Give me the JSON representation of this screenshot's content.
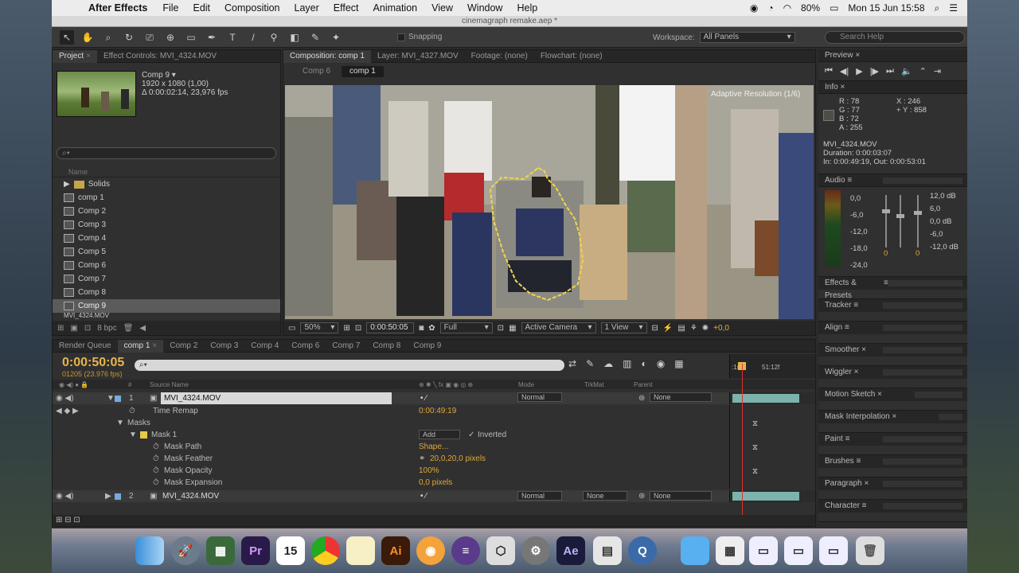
{
  "menubar": {
    "app_name": "After Effects",
    "menus": [
      "File",
      "Edit",
      "Composition",
      "Layer",
      "Effect",
      "Animation",
      "View",
      "Window",
      "Help"
    ],
    "battery": "80%",
    "clock": "Mon 15 Jun  15:58"
  },
  "window": {
    "title": "cinemagraph remake.aep *"
  },
  "toolbar": {
    "snapping_label": "Snapping",
    "workspace_label": "Workspace:",
    "workspace_value": "All Panels",
    "search_help_placeholder": "Search Help"
  },
  "project_panel": {
    "tab_project": "Project",
    "tab_effect_controls": "Effect Controls: MVI_4324.MOV",
    "selected_name": "Comp 9 ▾",
    "selected_dims": "1920 x 1080 (1,00)",
    "selected_duration": "Δ 0:00:02:14, 23,976 fps",
    "search_placeholder": "",
    "column_name": "Name",
    "items": [
      "Solids",
      "comp 1",
      "Comp 2",
      "Comp 3",
      "Comp 4",
      "Comp 5",
      "Comp 6",
      "Comp 7",
      "Comp 8",
      "Comp 9",
      "MVI_4324.MOV"
    ],
    "selected_index": 9,
    "bpc": "8 bpc"
  },
  "comp_panel": {
    "tab_composition": "Composition: comp 1",
    "tab_layer": "Layer: MVI_4327.MOV",
    "tab_footage": "Footage: (none)",
    "tab_flowchart": "Flowchart: (none)",
    "breadcrumbs": [
      "Comp 6",
      "comp 1"
    ],
    "adaptive_label": "Adaptive Resolution (1/6)",
    "zoom": "50%",
    "timecode": "0:00:50:05",
    "resolution": "Full",
    "camera": "Active Camera",
    "views": "1 View",
    "exposure": "+0,0"
  },
  "preview": {
    "title": "Preview",
    "controls": [
      "⏮",
      "◀|",
      "▶",
      "|▶",
      "⏭",
      "🔈",
      "⌃",
      "⇥"
    ]
  },
  "info": {
    "title": "Info",
    "r": "R : 78",
    "g": "G : 77",
    "b": "B : 72",
    "a": "A : 255",
    "x": "X : 246",
    "y": "+ Y : 858",
    "file": "MVI_4324.MOV",
    "duration": "Duration: 0:00:03:07",
    "inout": "In: 0:00:49:19, Out: 0:00:53:01"
  },
  "audio": {
    "title": "Audio",
    "left_scale": [
      "0,0",
      "-6,0",
      "-12,0",
      "-18,0",
      "-24,0"
    ],
    "right_scale": [
      "12,0 dB",
      "6,0",
      "0,0 dB",
      "-6,0",
      "-12,0 dB"
    ],
    "left_level": "0",
    "right_level": "0"
  },
  "right_panels": [
    "Effects & Presets",
    "Tracker",
    "Align",
    "Smoother",
    "Wiggler",
    "Motion Sketch",
    "Mask Interpolation",
    "Paint",
    "Brushes",
    "Paragraph",
    "Character"
  ],
  "timeline": {
    "tabs": [
      "Render Queue",
      "comp 1",
      "Comp 2",
      "Comp 3",
      "Comp 4",
      "Comp 6",
      "Comp 7",
      "Comp 8",
      "Comp 9"
    ],
    "active_tab": 1,
    "timecode": "0:00:50:05",
    "frames": "01205 (23.976 fps)",
    "search_placeholder": "",
    "ruler_labels": [
      ":1s",
      "51:12f"
    ],
    "col_source_name": "Source Name",
    "col_mode": "Mode",
    "col_trkmat": "TrkMat",
    "col_parent": "Parent",
    "layer1_num": "1",
    "layer1_name": "MVI_4324.MOV",
    "layer1_mode": "Normal",
    "layer1_parent": "None",
    "time_remap_label": "Time Remap",
    "time_remap_value": "0:00:49:19",
    "masks_label": "Masks",
    "mask1_label": "Mask 1",
    "mask1_mode": "Add",
    "mask1_inverted": "Inverted",
    "mask_path_label": "Mask Path",
    "mask_path_value": "Shape...",
    "mask_feather_label": "Mask Feather",
    "mask_feather_value": "20,0,20,0 pixels",
    "mask_opacity_label": "Mask Opacity",
    "mask_opacity_value": "100%",
    "mask_expansion_label": "Mask Expansion",
    "mask_expansion_value": "0,0 pixels",
    "layer2_num": "2",
    "layer2_name": "MVI_4324.MOV",
    "layer2_mode": "Normal",
    "layer2_trkmat": "None",
    "layer2_parent": "None"
  },
  "dock": {
    "items": [
      "finder-icon",
      "launchpad-icon",
      "photo-icon",
      "premiere-icon",
      "calendar-icon",
      "chrome-icon",
      "notes-icon",
      "illustrator-icon",
      "blender-icon",
      "eclipse-icon",
      "unity-icon",
      "system-prefs-icon",
      "after-effects-icon",
      "preview-icon",
      "quicktime-icon",
      "folder-icon",
      "trash-icon"
    ],
    "calendar_day": "15",
    "premiere_label": "Pr",
    "illustrator_label": "Ai",
    "ae_label": "Ae"
  }
}
